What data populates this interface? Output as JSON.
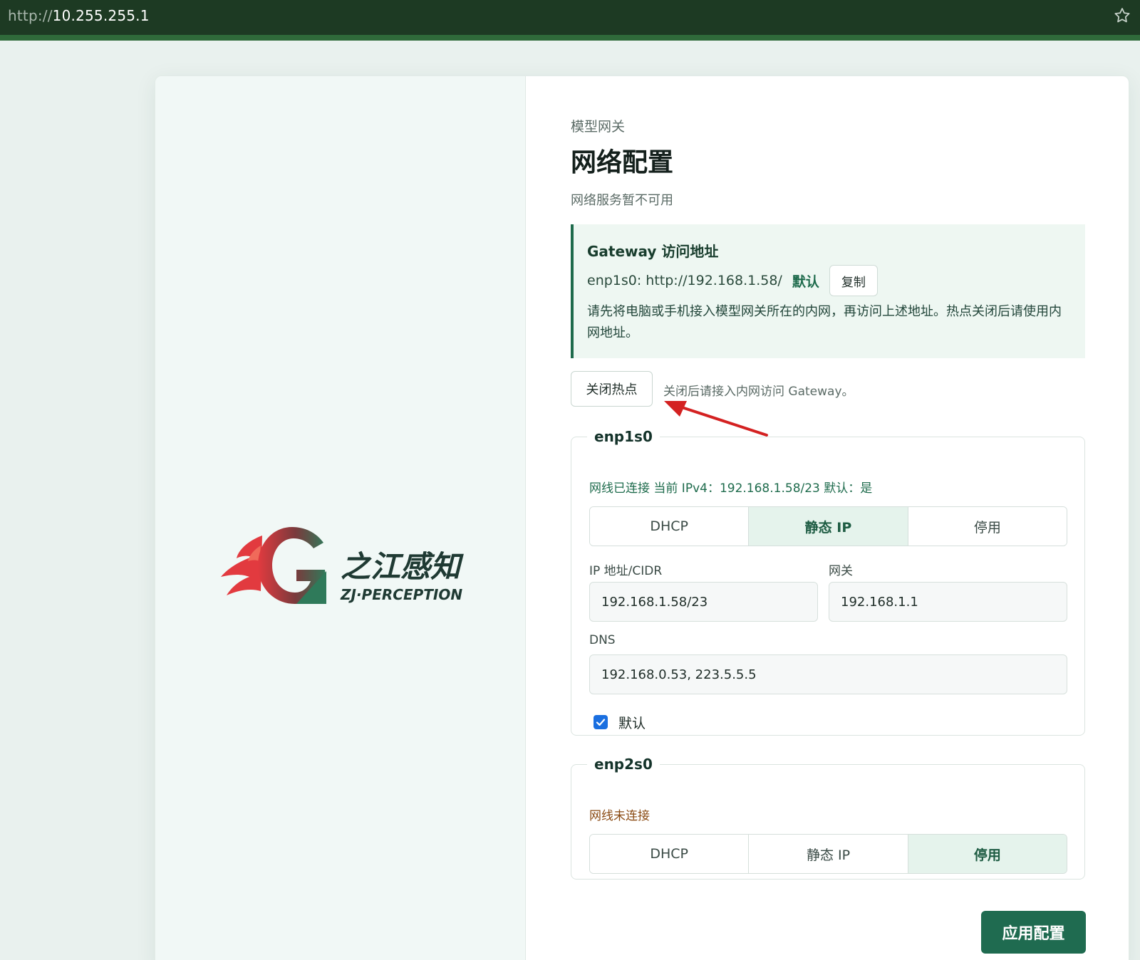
{
  "browser": {
    "url_protocol": "http://",
    "url_host": "10.255.255.1",
    "bookmark_icon": "star-icon"
  },
  "logo": {
    "name_cn": "之江感知",
    "name_en": "ZJ·PERCEPTION",
    "colors": {
      "flame": "#e23a3f",
      "g": "#2f7a5a"
    }
  },
  "header": {
    "eyebrow": "模型网关",
    "title": "网络配置",
    "subtitle": "网络服务暂不可用"
  },
  "gateway": {
    "title": "Gateway 访问地址",
    "address": "enp1s0: http://192.168.1.58/",
    "default_label": "默认",
    "copy_label": "复制",
    "note": "请先将电脑或手机接入模型网关所在的内网，再访问上述地址。热点关闭后请使用内网地址。"
  },
  "hotspot": {
    "button_label": "关闭热点",
    "hint": "关闭后请接入内网访问 Gateway。"
  },
  "interfaces": [
    {
      "name": "enp1s0",
      "status": "网线已连接 当前 IPv4：192.168.1.58/23 默认：是",
      "modes": [
        "DHCP",
        "静态 IP",
        "停用"
      ],
      "selected_mode": "静态 IP",
      "ip_label": "IP 地址/CIDR",
      "ip_value": "192.168.1.58/23",
      "gateway_label": "网关",
      "gateway_value": "192.168.1.1",
      "dns_label": "DNS",
      "dns_value": "192.168.0.53, 223.5.5.5",
      "default_checkbox_label": "默认",
      "default_checked": true
    },
    {
      "name": "enp2s0",
      "status": "网线未连接",
      "modes": [
        "DHCP",
        "静态 IP",
        "停用"
      ],
      "selected_mode": "停用"
    }
  ],
  "apply_label": "应用配置",
  "colors": {
    "accent": "#1f6b50",
    "status_ok": "#1e6b4c",
    "status_warn": "#8a4a12",
    "annotation_arrow": "#d42121"
  }
}
